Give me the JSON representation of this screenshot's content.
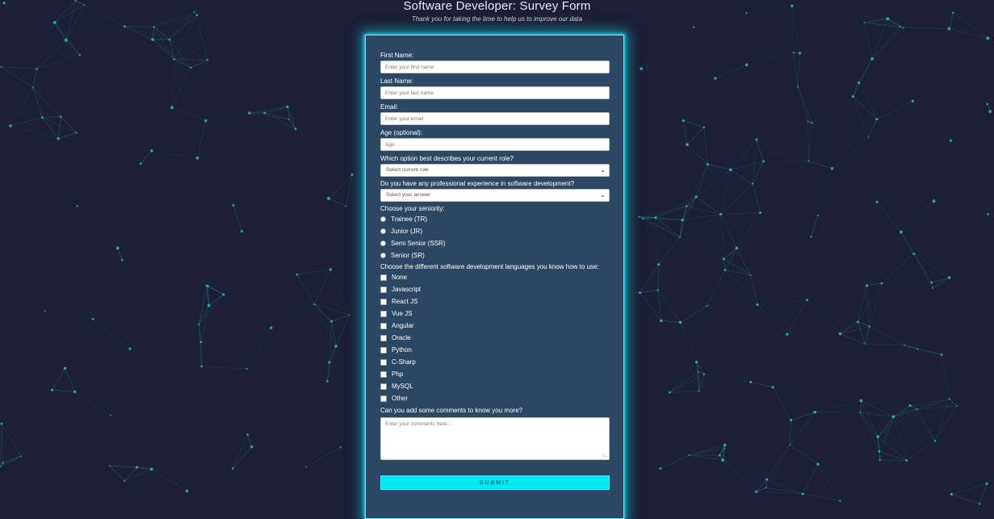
{
  "header": {
    "title": "Software Developer: Survey Form",
    "subtitle": "Thank you for taking the time to help us to improve our data"
  },
  "form": {
    "first_name": {
      "label": "First Name:",
      "placeholder": "Enter your first name"
    },
    "last_name": {
      "label": "Last Name:",
      "placeholder": "Enter your last name"
    },
    "email": {
      "label": "Email:",
      "placeholder": "Enter your email"
    },
    "age": {
      "label": "Age (optional):",
      "placeholder": "Age"
    },
    "role": {
      "label": "Which option best describes your current role?",
      "selected": "Select current role"
    },
    "experience": {
      "label": "Do you have any professional experience in software development?",
      "selected": "Select your answer"
    },
    "seniority": {
      "label": "Choose your seniority:",
      "options": [
        "Trainee (TR)",
        "Junior (JR)",
        "Semi Senior (SSR)",
        "Senior (SR)"
      ]
    },
    "languages": {
      "label": "Choose the different software development languages you know how to use:",
      "options": [
        "None",
        "Javascript",
        "React JS",
        "Vue JS",
        "Angular",
        "Oracle",
        "Python",
        "C-Sharp",
        "Php",
        "MySQL",
        "Other"
      ]
    },
    "comments": {
      "label": "Can you add some comments to know you more?",
      "placeholder": "Enter your comments here..."
    },
    "submit_label": "SUBMIT"
  },
  "colors": {
    "background": "#1c1f35",
    "card": "#2c4763",
    "accent": "#00e8f4"
  }
}
